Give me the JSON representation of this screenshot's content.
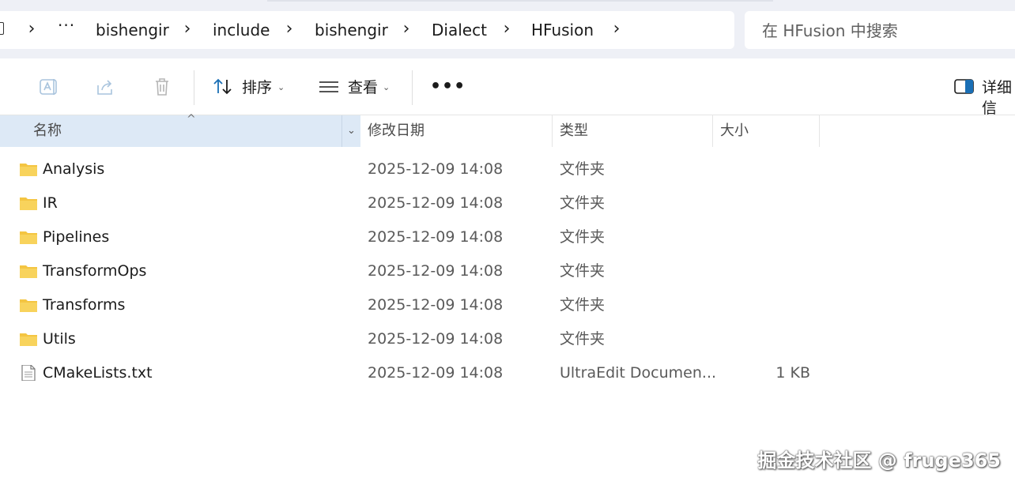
{
  "address_bar": {
    "crumbs": [
      "bishengir",
      "include",
      "bishengir",
      "Dialect",
      "HFusion"
    ],
    "overflow": "···"
  },
  "search": {
    "placeholder": "在 HFusion 中搜索"
  },
  "toolbar": {
    "sort_label": "排序",
    "view_label": "查看",
    "more_label": "•••",
    "details_label": "详细信"
  },
  "columns": {
    "name": "名称",
    "date": "修改日期",
    "type": "类型",
    "size": "大小"
  },
  "files": [
    {
      "name": "Analysis",
      "date": "2025-12-09 14:08",
      "type": "文件夹",
      "size": "",
      "icon": "folder-icon"
    },
    {
      "name": "IR",
      "date": "2025-12-09 14:08",
      "type": "文件夹",
      "size": "",
      "icon": "folder-icon"
    },
    {
      "name": "Pipelines",
      "date": "2025-12-09 14:08",
      "type": "文件夹",
      "size": "",
      "icon": "folder-icon"
    },
    {
      "name": "TransformOps",
      "date": "2025-12-09 14:08",
      "type": "文件夹",
      "size": "",
      "icon": "folder-icon"
    },
    {
      "name": "Transforms",
      "date": "2025-12-09 14:08",
      "type": "文件夹",
      "size": "",
      "icon": "folder-icon"
    },
    {
      "name": "Utils",
      "date": "2025-12-09 14:08",
      "type": "文件夹",
      "size": "",
      "icon": "folder-icon"
    },
    {
      "name": "CMakeLists.txt",
      "date": "2025-12-09 14:08",
      "type": "UltraEdit Documen...",
      "size": "1 KB",
      "icon": "text-file-icon"
    }
  ],
  "watermark": "掘金技术社区 @ fruge365",
  "colors": {
    "folder": "#f4c542",
    "header_selected": "#dde9f6",
    "toolbar_icon": "#1a6fb5"
  }
}
